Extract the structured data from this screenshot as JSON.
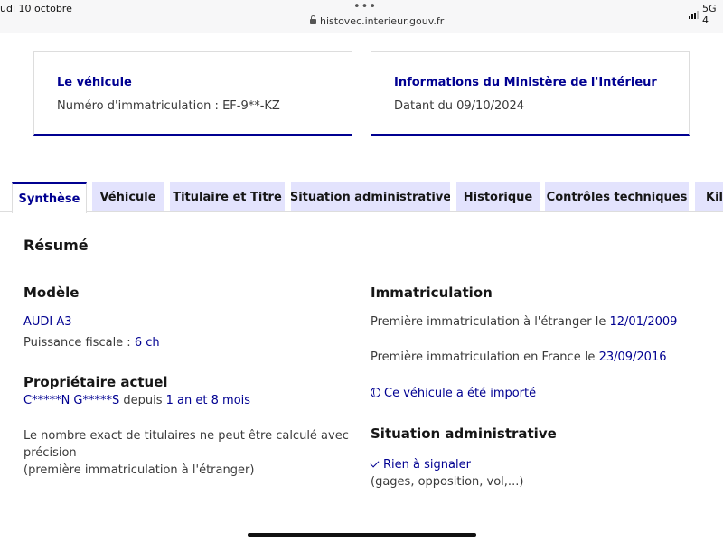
{
  "status_bar": {
    "date": "udi 10 octobre",
    "dots": "•••",
    "url": "histovec.interieur.gouv.fr",
    "network": "5G 4"
  },
  "cards": {
    "vehicle": {
      "title": "Le véhicule",
      "text": "Numéro d'immatriculation : EF-9**-KZ"
    },
    "ministry": {
      "title": "Informations du Ministère de l'Intérieur",
      "text": "Datant du 09/10/2024"
    }
  },
  "tabs": [
    {
      "label": "Synthèse",
      "active": true
    },
    {
      "label": "Véhicule"
    },
    {
      "label": "Titulaire et Titre"
    },
    {
      "label": "Situation administrative"
    },
    {
      "label": "Historique"
    },
    {
      "label": "Contrôles techniques"
    },
    {
      "label": "Kilo"
    }
  ],
  "summary": {
    "title": "Résumé",
    "model": {
      "heading": "Modèle",
      "name": "AUDI A3",
      "power_label": "Puissance fiscale : ",
      "power_value": "6 ch"
    },
    "owner": {
      "heading": "Propriétaire actuel",
      "name": "C*****N G*****S",
      "since_label": " depuis ",
      "since_value": "1 an et 8 mois",
      "note_line1": "Le nombre exact de titulaires ne peut être calculé avec",
      "note_line2": "précision",
      "note_line3": "(première immatriculation à l'étranger)"
    },
    "registration": {
      "heading": "Immatriculation",
      "foreign_label": "Première immatriculation à l'étranger le ",
      "foreign_date": "12/01/2009",
      "france_label": "Première immatriculation en France le ",
      "france_date": "23/09/2016",
      "imported": "Ce véhicule a été importé"
    },
    "admin": {
      "heading": "Situation administrative",
      "status": "Rien à signaler",
      "detail": "(gages, opposition, vol,...)"
    }
  },
  "colors": {
    "primary": "#000091",
    "tab_bg": "#e3e3fd",
    "text": "#3a3a3a"
  }
}
